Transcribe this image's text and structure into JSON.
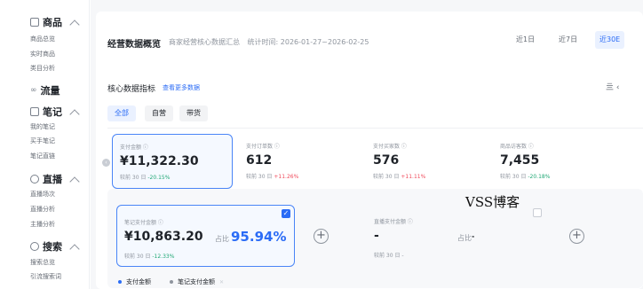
{
  "sidebar": {
    "sections": [
      {
        "title": "商品",
        "items": [
          "商品总览",
          "实时商品",
          "类目分析"
        ]
      },
      {
        "title": "流量",
        "items": []
      },
      {
        "title": "笔记",
        "items": [
          "我的笔记",
          "买手笔记",
          "笔记直链"
        ]
      },
      {
        "title": "直播",
        "items": [
          "直播场次",
          "直播分析",
          "主播分析"
        ]
      },
      {
        "title": "搜索",
        "items": [
          "搜索总览",
          "引流搜索词"
        ]
      }
    ]
  },
  "overview": {
    "title": "经营数据概览",
    "subtitle": "商家经营核心数据汇总",
    "stat_time": "统计时间: 2026-01-27~2026-02-25",
    "ranges": [
      "近1日",
      "近7日",
      "近30E"
    ],
    "active_range": "近30E"
  },
  "core": {
    "title": "核心数据指标",
    "more_link": "查看更多数据",
    "right_icon": "亖 ‹",
    "filters": [
      "全部",
      "自营",
      "带货"
    ],
    "active_filter": "全部"
  },
  "metrics": [
    {
      "label": "支付金额 ⓘ",
      "value": "¥11,322.30",
      "cmp_prefix": "较前 30 日",
      "cmp": "-20.15%",
      "trend": "down",
      "selected": true
    },
    {
      "label": "支付订单数 ⓘ",
      "value": "612",
      "cmp_prefix": "较前 30 日",
      "cmp": "+11.26%",
      "trend": "up",
      "selected": false
    },
    {
      "label": "支付买家数 ⓘ",
      "value": "576",
      "cmp_prefix": "较前 30 日",
      "cmp": "+11.11%",
      "trend": "up",
      "selected": false
    },
    {
      "label": "商品访客数 ⓘ",
      "value": "7,455",
      "cmp_prefix": "较前 30 日",
      "cmp": "-20.18%",
      "trend": "down",
      "selected": false
    }
  ],
  "sub_metrics": [
    {
      "label": "笔记支付金额 ⓘ",
      "value": "¥10,863.20",
      "share_label": "占比",
      "share": "95.94%",
      "cmp_prefix": "较前 30 日",
      "cmp": "-12.33%",
      "trend": "down",
      "checked": true
    },
    {
      "label": "直播支付金额 ⓘ",
      "value": "-",
      "share_label": "占比",
      "share": "-",
      "cmp_prefix": "较前 30 日",
      "cmp": "-",
      "trend": "none",
      "checked": false
    }
  ],
  "legend": [
    {
      "label": "支付金额",
      "color": "#2b6cf6"
    },
    {
      "label": "笔记支付金额",
      "color": "#8f959e"
    }
  ],
  "watermark": "VSS博客",
  "colors": {
    "accent": "#2b6cf6",
    "down": "#1fa774",
    "up": "#f04a5b"
  }
}
